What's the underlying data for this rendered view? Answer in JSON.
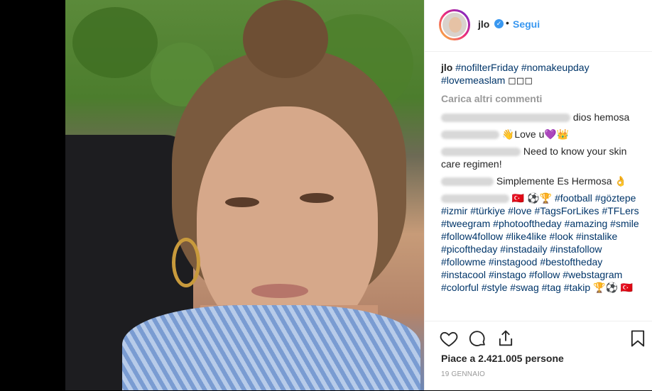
{
  "post": {
    "username": "jlo",
    "verified_mark": "✓",
    "dot": "•",
    "follow_label": "Segui",
    "caption": {
      "user": "jlo",
      "tags": [
        "#nofilterFriday",
        "#nomakeupday",
        "#lovemeaslam"
      ],
      "tail": "◻◻◻"
    },
    "load_more": "Carica altri commenti",
    "comments": [
      {
        "text": "dios hemosa"
      },
      {
        "text": "👋Love u💜👑"
      },
      {
        "text": "Need to know your skin care regimen!"
      },
      {
        "text": "Simplemente Es Hermosa 👌"
      },
      {
        "text": "🇹🇷 ⚽🏆"
      }
    ],
    "hashtag_comment": [
      "#football",
      "#göztepe",
      "#izmir",
      "#türkiye",
      "#love",
      "#TagsForLikes",
      "#TFLers",
      "#tweegram",
      "#photooftheday",
      "#amazing",
      "#smile",
      "#follow4follow",
      "#like4like",
      "#look",
      "#instalike",
      "#picoftheday",
      "#instadaily",
      "#instafollow",
      "#followme",
      "#instagood",
      "#bestoftheday",
      "#instacool",
      "#instago",
      "#follow",
      "#webstagram",
      "#colorful",
      "#style",
      "#swag",
      "#tag",
      "#takip"
    ],
    "hashtag_tail": "🏆⚽ 🇹🇷",
    "likes": "Piace a 2.421.005 persone",
    "date": "19 GENNAIO"
  },
  "colors": {
    "link": "#3897f0",
    "hashtag": "#003569",
    "muted": "#999999",
    "text": "#262626"
  },
  "icons": [
    "heart-icon",
    "comment-icon",
    "share-icon",
    "bookmark-icon"
  ]
}
